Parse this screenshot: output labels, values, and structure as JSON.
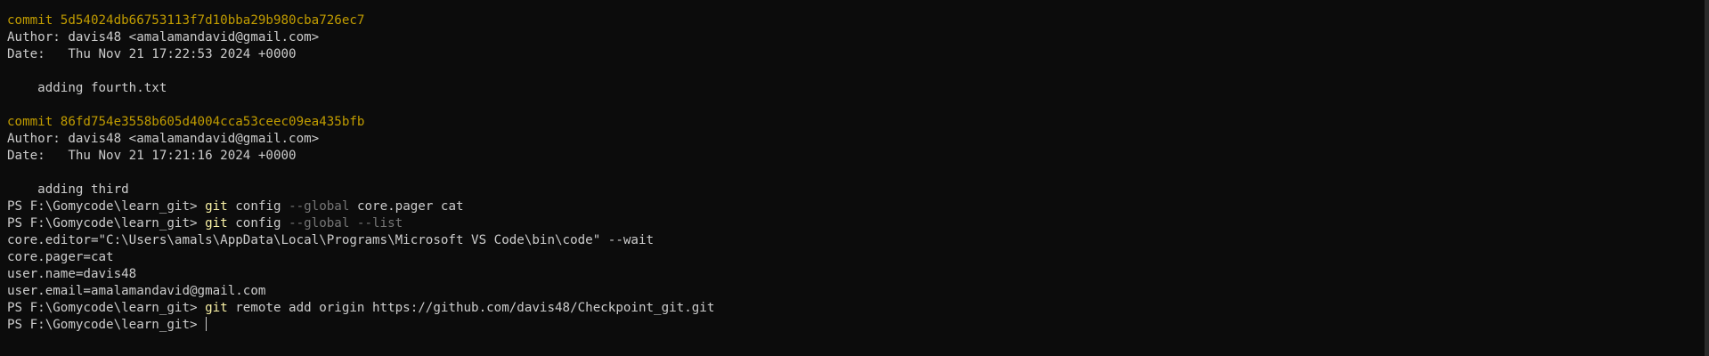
{
  "terminal": {
    "commits": [
      {
        "line": "commit 5d54024db66753113f7d10bba29b980cba726ec7",
        "author": "Author: davis48 <amalamandavid@gmail.com>",
        "date": "Date:   Thu Nov 21 17:22:53 2024 +0000",
        "message": "    adding fourth.txt"
      },
      {
        "line": "commit 86fd754e3558b605d4004cca53ceec09ea435bfb",
        "author": "Author: davis48 <amalamandavid@gmail.com>",
        "date": "Date:   Thu Nov 21 17:21:16 2024 +0000",
        "message": "    adding third"
      }
    ],
    "prompt": "PS F:\\Gomycode\\learn_git> ",
    "cmd1": {
      "git": "git",
      "sub": " config ",
      "flag": "--global",
      "rest": " core.pager cat"
    },
    "cmd2": {
      "git": "git",
      "sub": " config ",
      "flag": "--global --list"
    },
    "config_output": [
      "core.editor=\"C:\\Users\\amals\\AppData\\Local\\Programs\\Microsoft VS Code\\bin\\code\" --wait",
      "core.pager=cat",
      "user.name=davis48",
      "user.email=amalamandavid@gmail.com"
    ],
    "cmd3": {
      "git": "git",
      "rest": " remote add origin https://github.com/davis48/Checkpoint_git.git"
    }
  },
  "colors": {
    "background": "#0c0c0c",
    "text": "#cccccc",
    "commit_hash": "#c19c00",
    "git_command": "#f9f1a5",
    "flag": "#767676"
  }
}
